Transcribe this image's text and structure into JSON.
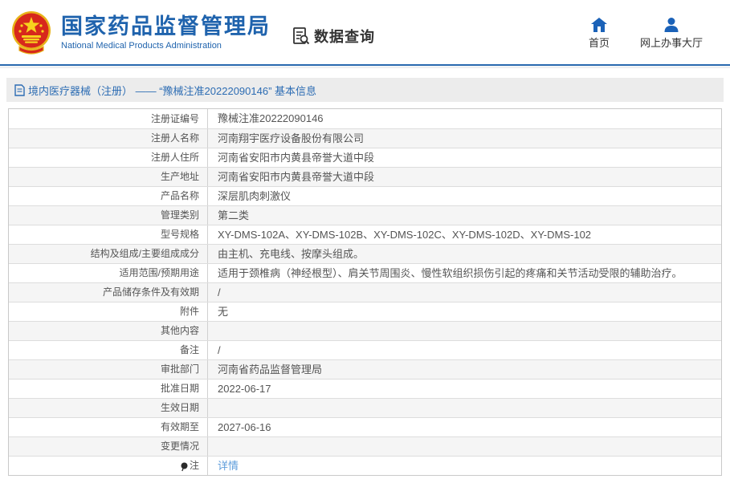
{
  "header": {
    "org_name_zh": "国家药品监督管理局",
    "org_name_en": "National Medical Products Administration",
    "section_title": "数据查询",
    "nav_home": "首页",
    "nav_hall": "网上办事大厅"
  },
  "breadcrumb": "境内医疗器械（注册） —— “豫械注准20222090146” 基本信息",
  "table": {
    "rows": [
      {
        "label": "注册证编号",
        "value": "豫械注准20222090146"
      },
      {
        "label": "注册人名称",
        "value": "河南翔宇医疗设备股份有限公司"
      },
      {
        "label": "注册人住所",
        "value": "河南省安阳市内黄县帝誉大道中段"
      },
      {
        "label": "生产地址",
        "value": "河南省安阳市内黄县帝誉大道中段"
      },
      {
        "label": "产品名称",
        "value": "深层肌肉刺激仪"
      },
      {
        "label": "管理类别",
        "value": "第二类"
      },
      {
        "label": "型号规格",
        "value": "XY-DMS-102A、XY-DMS-102B、XY-DMS-102C、XY-DMS-102D、XY-DMS-102"
      },
      {
        "label": "结构及组成/主要组成成分",
        "value": "由主机、充电线、按摩头组成。"
      },
      {
        "label": "适用范围/预期用途",
        "value": "适用于颈椎病（神经根型）、肩关节周围炎、慢性软组织损伤引起的疼痛和关节活动受限的辅助治疗。"
      },
      {
        "label": "产品储存条件及有效期",
        "value": "/"
      },
      {
        "label": "附件",
        "value": "无"
      },
      {
        "label": "其他内容",
        "value": ""
      },
      {
        "label": "备注",
        "value": "/"
      },
      {
        "label": "审批部门",
        "value": "河南省药品监督管理局"
      },
      {
        "label": "批准日期",
        "value": "2022-06-17"
      },
      {
        "label": "生效日期",
        "value": ""
      },
      {
        "label": "有效期至",
        "value": "2027-06-16"
      },
      {
        "label": "变更情况",
        "value": ""
      },
      {
        "label": "注",
        "value": "详情",
        "value_is_link": true,
        "label_icon": "note-balloon-icon"
      }
    ]
  },
  "colors": {
    "brand_blue": "#1f63ad",
    "link_blue": "#5e9ddb",
    "breadcrumb_text": "#2c6cb3",
    "header_rule": "#2a6ab0",
    "alt_row_bg": "#f5f5f5"
  }
}
